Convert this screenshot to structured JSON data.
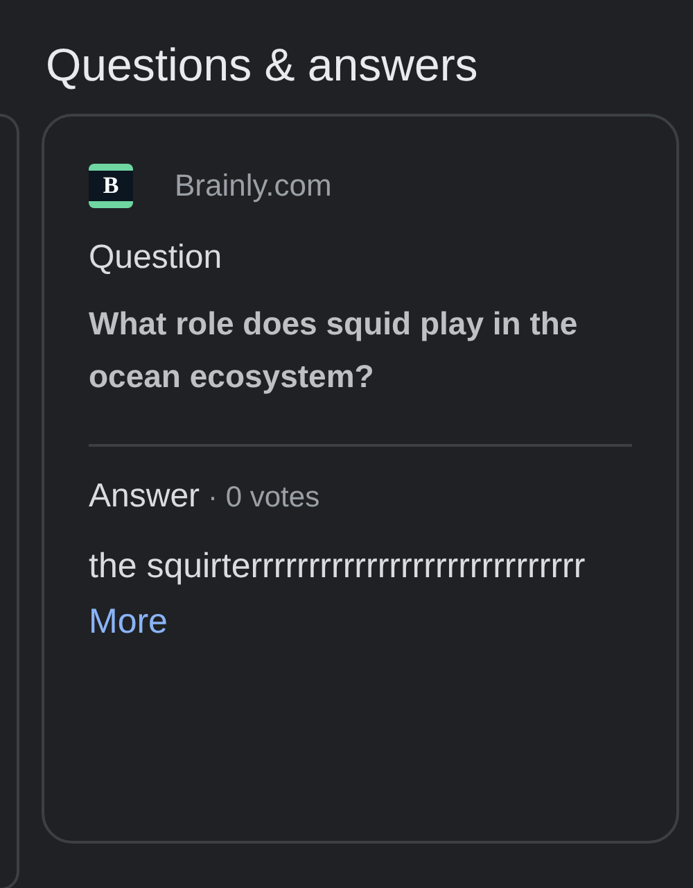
{
  "heading": "Questions & answers",
  "card": {
    "logo_letter": "B",
    "source": "Brainly.com",
    "question_label": "Question",
    "question": "What role does squid play in the ocean ecosystem?",
    "answer_label": "Answer",
    "votes": "· 0 votes",
    "answer": "the squirterrrrrrrrrrrrrrrrrrrrrrrrrrrrr",
    "more": "More"
  }
}
